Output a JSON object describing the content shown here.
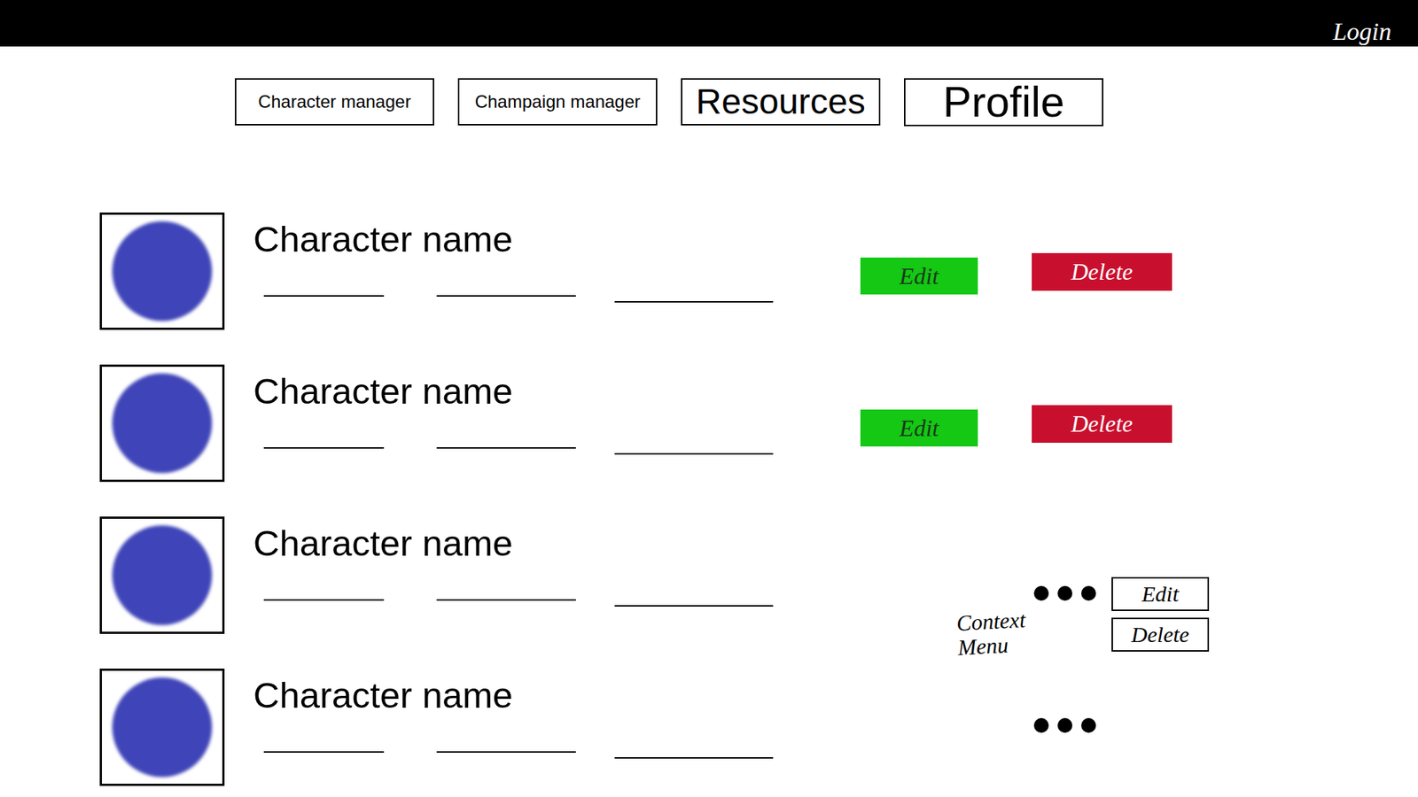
{
  "header": {
    "login": "Login"
  },
  "nav": [
    "Character manager",
    "Champaign manager",
    "Resources",
    "Profile"
  ],
  "characters": [
    {
      "name": "Character name",
      "kind": "buttons",
      "actions": [
        "Edit",
        "Delete"
      ]
    },
    {
      "name": "Character name",
      "kind": "buttons",
      "actions": [
        "Edit",
        "Delete"
      ]
    },
    {
      "name": "Character name",
      "kind": "menu",
      "menu": {
        "open": true,
        "items": [
          "Edit",
          "Delete"
        ]
      },
      "note": "Context Menu"
    },
    {
      "name": "Character name",
      "kind": "menu",
      "menu": {
        "open": false
      }
    }
  ]
}
